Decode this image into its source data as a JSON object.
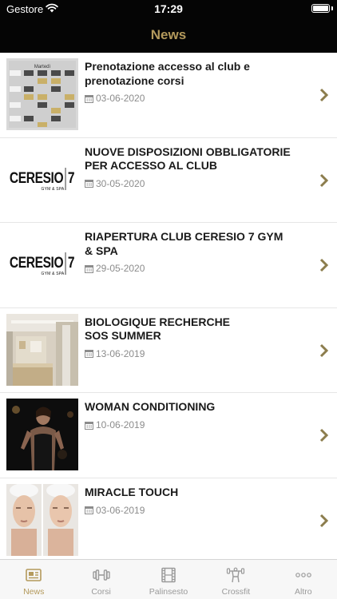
{
  "status_bar": {
    "carrier": "Gestore",
    "time": "17:29"
  },
  "nav": {
    "title": "News"
  },
  "news": [
    {
      "title": "Prenotazione accesso al club e\nprenotazione corsi",
      "date": "03-06-2020",
      "thumb_text": "Martedì"
    },
    {
      "title": "NUOVE DISPOSIZIONI OBBLIGATORIE\nPER ACCESSO AL CLUB",
      "date": "30-05-2020",
      "logo": {
        "name": "CERESIO",
        "number": "7",
        "tagline": "GYM & SPA"
      }
    },
    {
      "title": "RIAPERTURA CLUB CERESIO 7 GYM\n& SPA",
      "date": "29-05-2020",
      "logo": {
        "name": "CERESIO",
        "number": "7",
        "tagline": "GYM & SPA"
      }
    },
    {
      "title": "BIOLOGIQUE RECHERCHE\nSOS SUMMER",
      "date": "13-06-2019"
    },
    {
      "title": "WOMAN CONDITIONING",
      "date": "10-06-2019"
    },
    {
      "title": "MIRACLE TOUCH",
      "date": "03-06-2019"
    }
  ],
  "tabs": [
    {
      "label": "News",
      "icon": "newspaper-icon",
      "active": true
    },
    {
      "label": "Corsi",
      "icon": "dumbbell-icon",
      "active": false
    },
    {
      "label": "Palinsesto",
      "icon": "film-icon",
      "active": false
    },
    {
      "label": "Crossfit",
      "icon": "crossfit-icon",
      "active": false
    },
    {
      "label": "Altro",
      "icon": "more-icon",
      "active": false
    }
  ],
  "colors": {
    "accent": "#b49a5c",
    "header_bg": "#050505",
    "date_gray": "#8c8c8c",
    "tab_inactive": "#9a9a9a"
  }
}
